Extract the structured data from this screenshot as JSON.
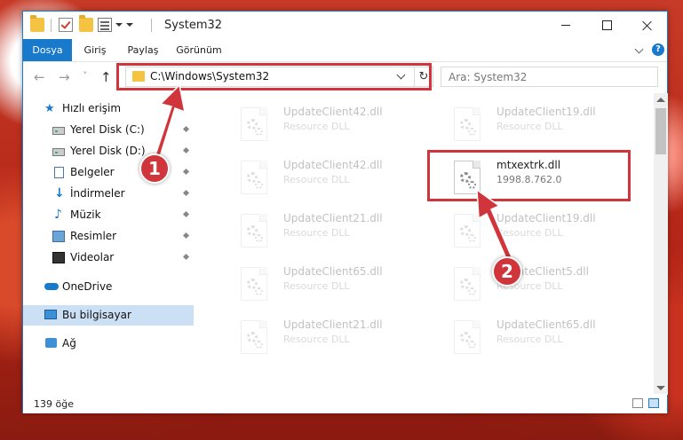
{
  "window": {
    "title": "System32"
  },
  "ribbon": {
    "tabs": [
      {
        "label": "Dosya",
        "active": true
      },
      {
        "label": "Giriş",
        "active": false
      },
      {
        "label": "Paylaş",
        "active": false
      },
      {
        "label": "Görünüm",
        "active": false
      }
    ],
    "help_label": "?"
  },
  "nav": {
    "back_label": "←",
    "forward_label": "→",
    "recent_label": "˅",
    "up_label": "↑",
    "address": "C:\\Windows\\System32",
    "refresh_label": "↻",
    "search_placeholder": "Ara: System32"
  },
  "sidebar": {
    "quick_access": "Hızlı erişim",
    "items": [
      {
        "label": "Yerel Disk (C:)",
        "icon": "drive-icon"
      },
      {
        "label": "Yerel Disk (D:)",
        "icon": "drive-icon"
      },
      {
        "label": "Belgeler",
        "icon": "documents-icon"
      },
      {
        "label": "İndirmeler",
        "icon": "downloads-icon"
      },
      {
        "label": "Müzik",
        "icon": "music-icon"
      },
      {
        "label": "Resimler",
        "icon": "pictures-icon"
      },
      {
        "label": "Videolar",
        "icon": "videos-icon"
      }
    ],
    "onedrive": "OneDrive",
    "this_pc": "Bu bilgisayar",
    "network": "Ağ"
  },
  "files": [
    {
      "name": "UpdateClient42.dll",
      "sub": "Resource DLL",
      "faded": true
    },
    {
      "name": "UpdateClient19.dll",
      "sub": "Resource DLL",
      "faded": true
    },
    {
      "name": "UpdateClient42.dll",
      "sub": "Resource DLL",
      "faded": true
    },
    {
      "name": "mtxextrk.dll",
      "sub": "1998.8.762.0",
      "faded": false
    },
    {
      "name": "UpdateClient21.dll",
      "sub": "Resource DLL",
      "faded": true
    },
    {
      "name": "UpdateClient19.dll",
      "sub": "Resource DLL",
      "faded": true
    },
    {
      "name": "UpdateClient65.dll",
      "sub": "Resource DLL",
      "faded": true
    },
    {
      "name": "UpdateClient5.dll",
      "sub": "Resource DLL",
      "faded": true
    },
    {
      "name": "UpdateClient21.dll",
      "sub": "Resource DLL",
      "faded": true
    },
    {
      "name": "UpdateClient65.dll",
      "sub": "Resource DLL",
      "faded": true
    }
  ],
  "status": {
    "count": "139 öğe"
  },
  "annotations": {
    "badge1": "1",
    "badge2": "2",
    "highlight_color": "#d0353b"
  },
  "colors": {
    "accent": "#1979ca",
    "selected": "#cce0f5"
  }
}
